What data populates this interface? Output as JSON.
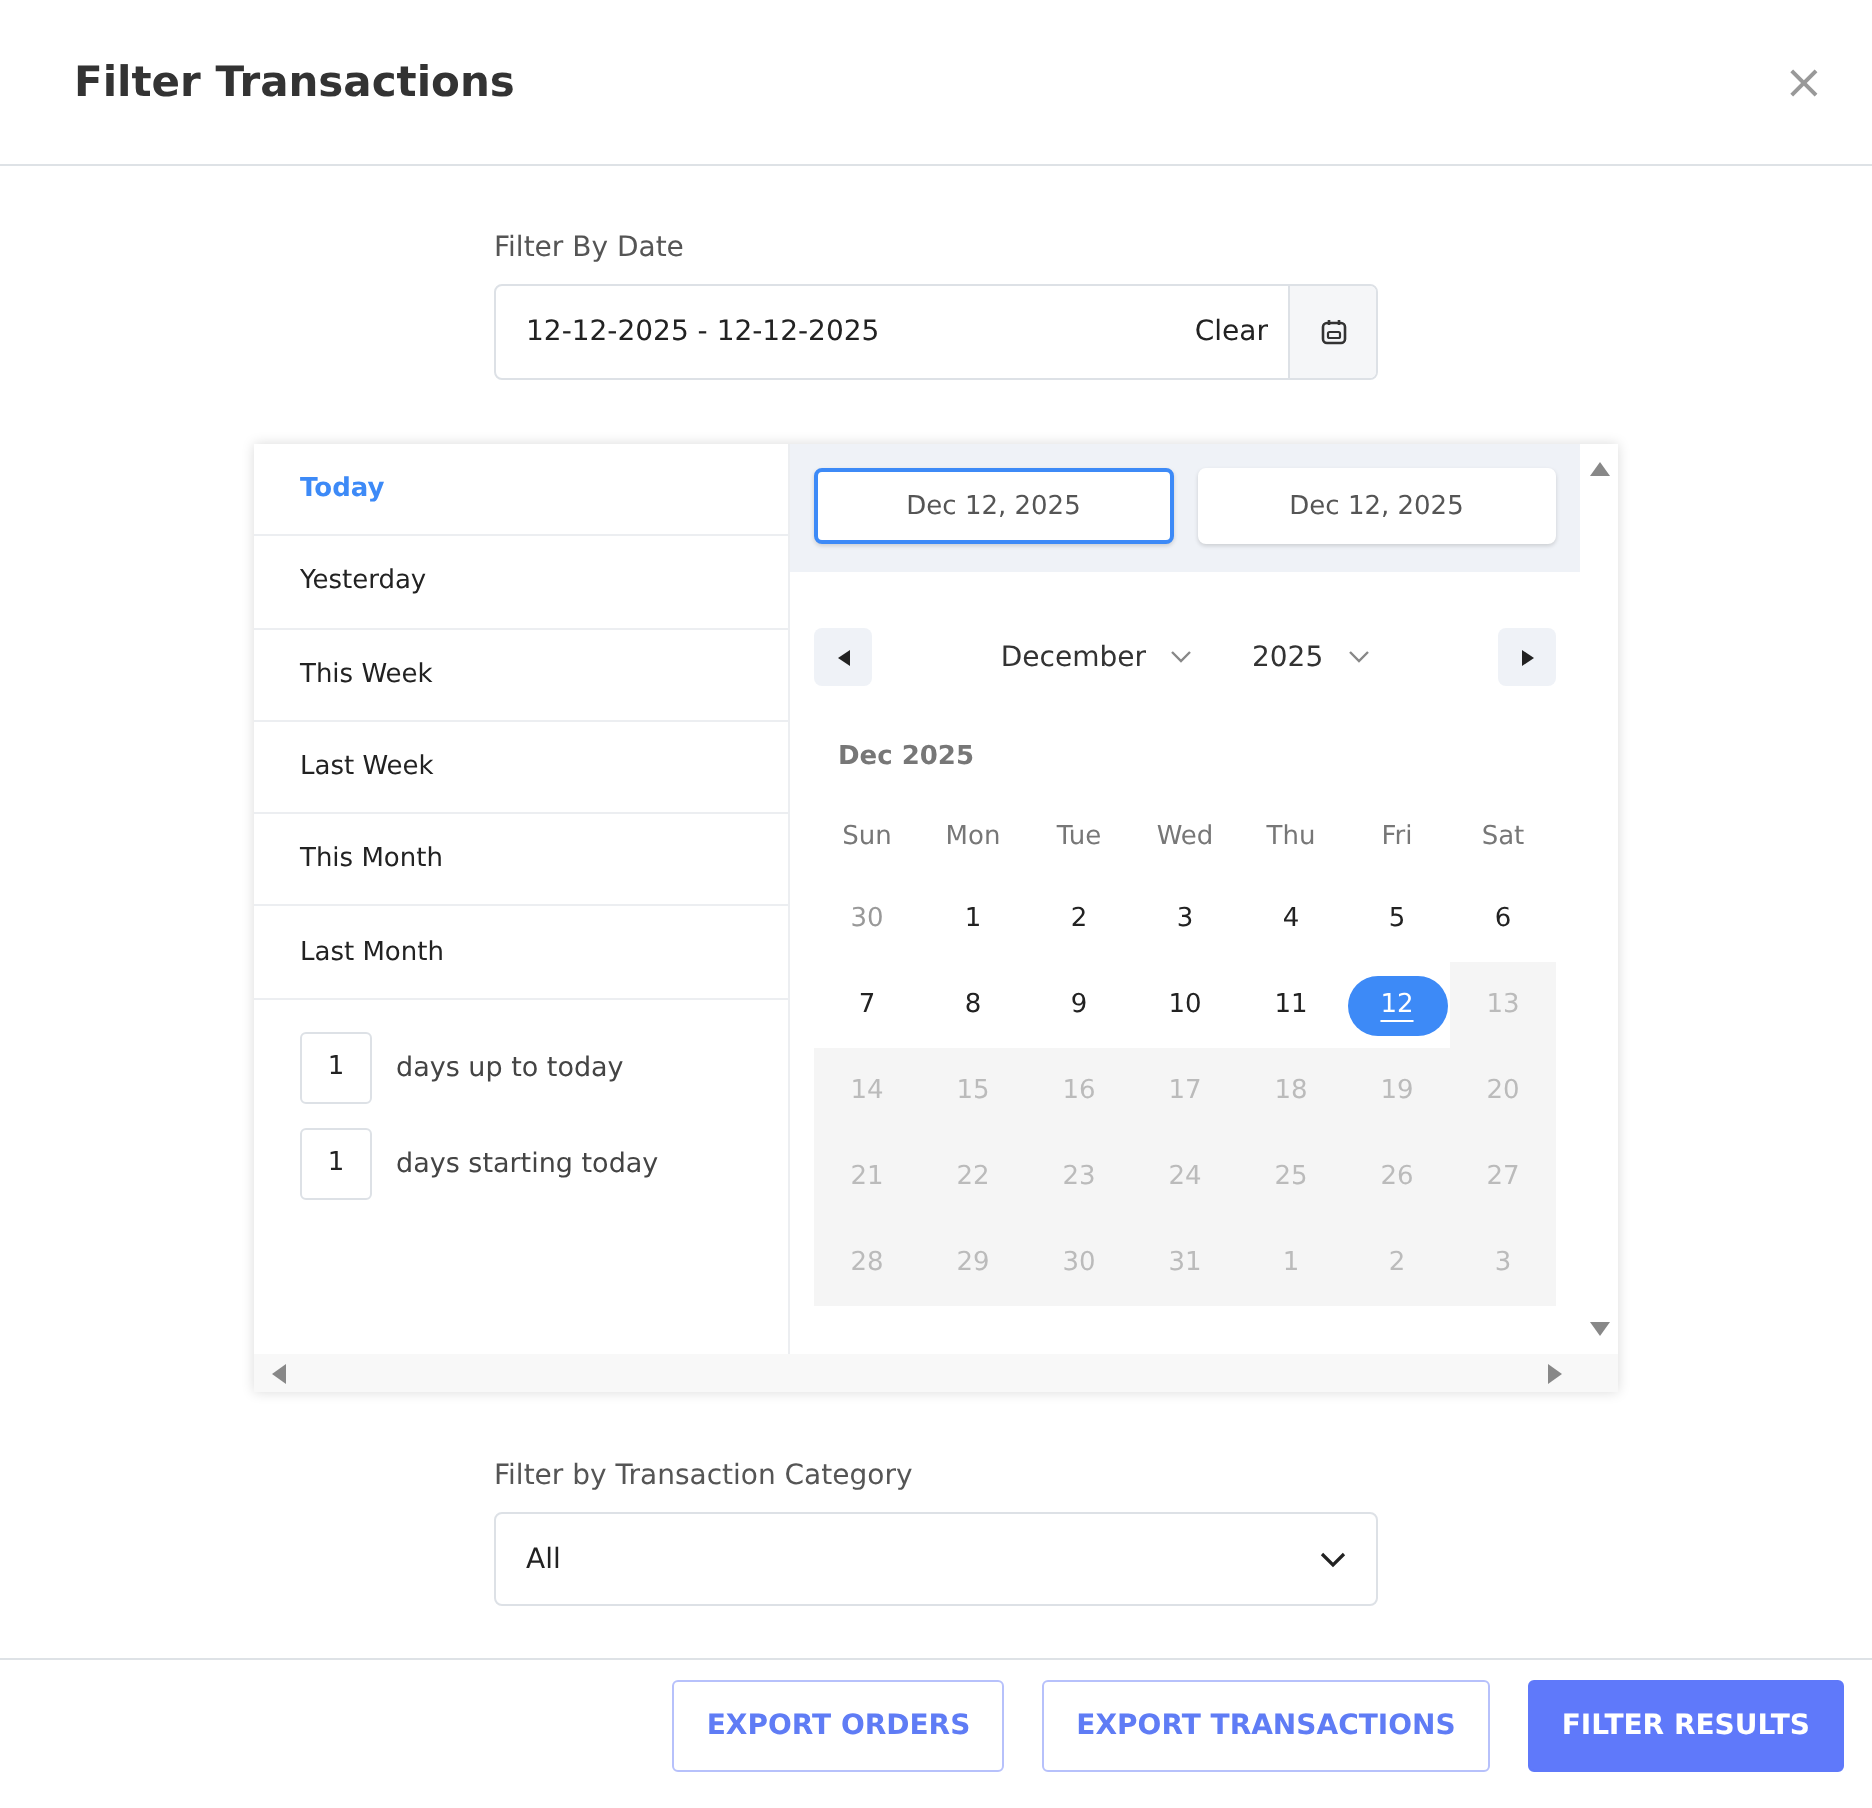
{
  "window": {
    "title": "Filter Transactions",
    "close": "×"
  },
  "date_filter": {
    "label": "Filter By Date",
    "value": "12-12-2025 - 12-12-2025",
    "clear": "Clear"
  },
  "picker": {
    "presets": [
      {
        "label": "Today",
        "selected": true
      },
      {
        "label": "Yesterday",
        "selected": false
      },
      {
        "label": "This Week",
        "selected": false
      },
      {
        "label": "Last Week",
        "selected": false
      },
      {
        "label": "This Month",
        "selected": false
      },
      {
        "label": "Last Month",
        "selected": false
      }
    ],
    "day_inputs": [
      {
        "value": "1",
        "label": "days up to today"
      },
      {
        "value": "1",
        "label": "days starting today"
      }
    ],
    "range_inputs": [
      {
        "value": "Dec 12, 2025",
        "selected": true
      },
      {
        "value": "Dec 12, 2025",
        "selected": false
      }
    ],
    "month": "December",
    "year": "2025",
    "caption": "Dec 2025",
    "weekdays": [
      "Sun",
      "Mon",
      "Tue",
      "Wed",
      "Thu",
      "Fri",
      "Sat"
    ],
    "weeks": [
      [
        {
          "label": "30",
          "kind": "other",
          "selected": false
        },
        {
          "label": "1",
          "kind": "normal",
          "selected": false
        },
        {
          "label": "2",
          "kind": "normal",
          "selected": false
        },
        {
          "label": "3",
          "kind": "normal",
          "selected": false
        },
        {
          "label": "4",
          "kind": "normal",
          "selected": false
        },
        {
          "label": "5",
          "kind": "normal",
          "selected": false
        },
        {
          "label": "6",
          "kind": "normal",
          "selected": false
        }
      ],
      [
        {
          "label": "7",
          "kind": "normal",
          "selected": false
        },
        {
          "label": "8",
          "kind": "normal",
          "selected": false
        },
        {
          "label": "9",
          "kind": "normal",
          "selected": false
        },
        {
          "label": "10",
          "kind": "normal",
          "selected": false
        },
        {
          "label": "11",
          "kind": "normal",
          "selected": false
        },
        {
          "label": "12",
          "kind": "normal",
          "selected": true
        },
        {
          "label": "13",
          "kind": "disabled",
          "selected": false
        }
      ],
      [
        {
          "label": "14",
          "kind": "disabled",
          "selected": false
        },
        {
          "label": "15",
          "kind": "disabled",
          "selected": false
        },
        {
          "label": "16",
          "kind": "disabled",
          "selected": false
        },
        {
          "label": "17",
          "kind": "disabled",
          "selected": false
        },
        {
          "label": "18",
          "kind": "disabled",
          "selected": false
        },
        {
          "label": "19",
          "kind": "disabled",
          "selected": false
        },
        {
          "label": "20",
          "kind": "disabled",
          "selected": false
        }
      ],
      [
        {
          "label": "21",
          "kind": "disabled",
          "selected": false
        },
        {
          "label": "22",
          "kind": "disabled",
          "selected": false
        },
        {
          "label": "23",
          "kind": "disabled",
          "selected": false
        },
        {
          "label": "24",
          "kind": "disabled",
          "selected": false
        },
        {
          "label": "25",
          "kind": "disabled",
          "selected": false
        },
        {
          "label": "26",
          "kind": "disabled",
          "selected": false
        },
        {
          "label": "27",
          "kind": "disabled",
          "selected": false
        }
      ],
      [
        {
          "label": "28",
          "kind": "disabled",
          "selected": false
        },
        {
          "label": "29",
          "kind": "disabled",
          "selected": false
        },
        {
          "label": "30",
          "kind": "disabled",
          "selected": false
        },
        {
          "label": "31",
          "kind": "disabled",
          "selected": false
        },
        {
          "label": "1",
          "kind": "disabled",
          "selected": false
        },
        {
          "label": "2",
          "kind": "disabled",
          "selected": false
        },
        {
          "label": "3",
          "kind": "disabled",
          "selected": false
        }
      ]
    ]
  },
  "category_filter": {
    "label": "Filter by Transaction Category",
    "value": "All"
  },
  "buttons": [
    {
      "label": "EXPORT ORDERS",
      "kind": "outline"
    },
    {
      "label": "EXPORT TRANSACTIONS",
      "kind": "outline"
    },
    {
      "label": "FILTER RESULTS",
      "kind": "primary"
    }
  ]
}
